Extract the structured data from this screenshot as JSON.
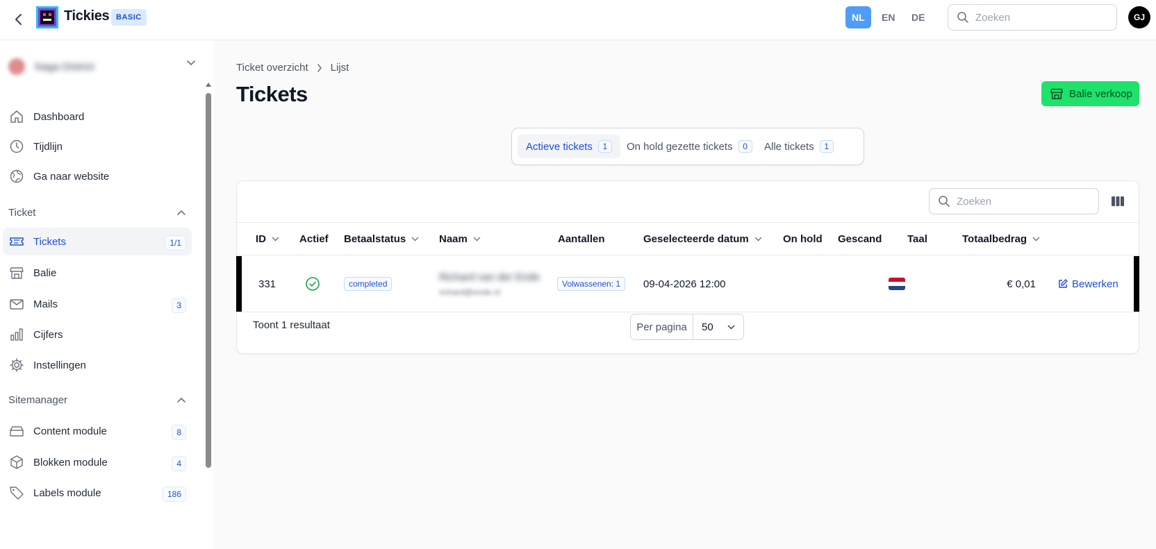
{
  "app": {
    "title": "Tickies",
    "plan": "BASIC"
  },
  "languages": [
    {
      "code": "NL",
      "active": true
    },
    {
      "code": "EN",
      "active": false
    },
    {
      "code": "DE",
      "active": false
    }
  ],
  "top_search": {
    "placeholder": "Zoeken"
  },
  "user": {
    "initials": "GJ"
  },
  "sidebar": {
    "org_name": "Naga District",
    "items_main": [
      {
        "label": "Dashboard",
        "icon": "home-icon"
      },
      {
        "label": "Tijdlijn",
        "icon": "clock-icon"
      },
      {
        "label": "Ga naar website",
        "icon": "globe-icon"
      }
    ],
    "sections": [
      {
        "label": "Ticket",
        "items": [
          {
            "label": "Tickets",
            "icon": "ticket-icon",
            "count": "1/1",
            "active": true
          },
          {
            "label": "Balie",
            "icon": "store-icon"
          },
          {
            "label": "Mails",
            "icon": "mail-icon",
            "count": "3"
          },
          {
            "label": "Cijfers",
            "icon": "chart-icon"
          },
          {
            "label": "Instellingen",
            "icon": "gear-icon"
          }
        ]
      },
      {
        "label": "Sitemanager",
        "items": [
          {
            "label": "Content module",
            "icon": "layers-icon",
            "count": "8"
          },
          {
            "label": "Blokken module",
            "icon": "cube-icon",
            "count": "4"
          },
          {
            "label": "Labels module",
            "icon": "tag-icon",
            "count": "186"
          }
        ]
      }
    ]
  },
  "breadcrumb": [
    "Ticket overzicht",
    "Lijst"
  ],
  "page_title": "Tickets",
  "primary_action": "Balie verkoop",
  "tabs": [
    {
      "label": "Actieve tickets",
      "count": "1",
      "active": true
    },
    {
      "label": "On hold gezette tickets",
      "count": "0",
      "active": false
    },
    {
      "label": "Alle tickets",
      "count": "1",
      "active": false
    }
  ],
  "table": {
    "search_placeholder": "Zoeken",
    "columns": [
      {
        "label": "ID",
        "sortable": true
      },
      {
        "label": "Actief",
        "sortable": false
      },
      {
        "label": "Betaalstatus",
        "sortable": true
      },
      {
        "label": "Naam",
        "sortable": true
      },
      {
        "label": "Aantallen",
        "sortable": false
      },
      {
        "label": "Geselecteerde datum",
        "sortable": true
      },
      {
        "label": "On hold",
        "sortable": false
      },
      {
        "label": "Gescand",
        "sortable": false
      },
      {
        "label": "Taal",
        "sortable": false
      },
      {
        "label": "Totaalbedrag",
        "sortable": true
      }
    ],
    "rows": [
      {
        "id": "331",
        "active": true,
        "payment_status": "completed",
        "name": "Richard van der Ende",
        "email": "richard@ende.nl",
        "quantities": "Volwassenen: 1",
        "date": "09-04-2026 12:00",
        "on_hold": "",
        "scanned": "",
        "language_flag": "nl-flag-icon",
        "total": "€ 0,01",
        "edit_label": "Bewerken"
      }
    ],
    "result_count": "Toont 1 resultaat",
    "per_page_label": "Per pagina",
    "per_page_value": "50"
  },
  "colors": {
    "accent": "#1d4ed8",
    "primary_button": "#1ee26b",
    "active_lang": "#4f9cf9",
    "success": "#16a34a"
  }
}
